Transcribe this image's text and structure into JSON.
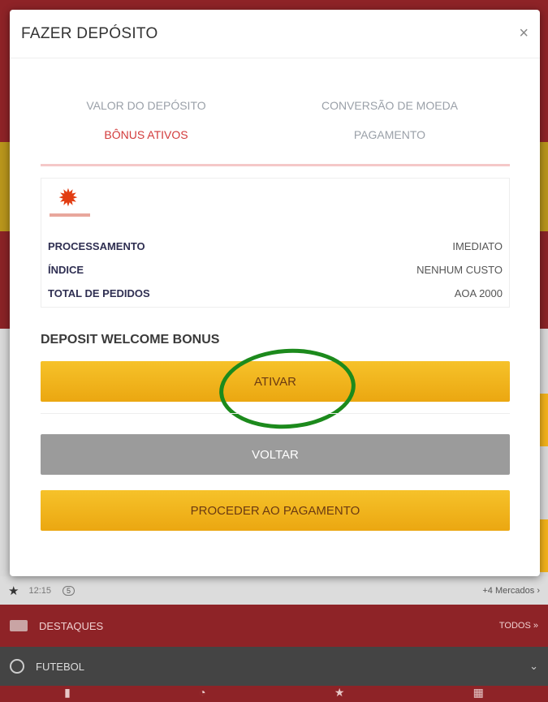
{
  "modal": {
    "title": "FAZER DEPÓSITO",
    "close_label": "×",
    "steps": [
      {
        "label": "VALOR DO DEPÓSITO",
        "active": false
      },
      {
        "label": "CONVERSÃO DE MOEDA",
        "active": false
      },
      {
        "label": "BÔNUS ATIVOS",
        "active": true
      },
      {
        "label": "PAGAMENTO",
        "active": false
      }
    ],
    "info": {
      "logo_icon": "gear-logo-icon",
      "rows": [
        {
          "label": "PROCESSAMENTO",
          "value": "IMEDIATO"
        },
        {
          "label": "ÍNDICE",
          "value": "NENHUM CUSTO"
        },
        {
          "label": "TOTAL DE PEDIDOS",
          "value": "AOA 2000"
        }
      ]
    },
    "bonus_title": "DEPOSIT WELCOME BONUS",
    "activate_label": "ATIVAR",
    "back_label": "VOLTAR",
    "pay_label": "PROCEDER AO PAGAMENTO"
  },
  "background": {
    "match_time": "12:15",
    "tv_badge": "5",
    "markets_link": "+4 Mercados",
    "destaques_label": "DESTAQUES",
    "todos_label": "TODOS",
    "futebol_label": "FUTEBOL"
  },
  "colors": {
    "accent_red": "#d23a3a",
    "button_yellow": "#f2b21a",
    "button_gray": "#9b9b9b",
    "annotation_green": "#1c8a1c"
  }
}
